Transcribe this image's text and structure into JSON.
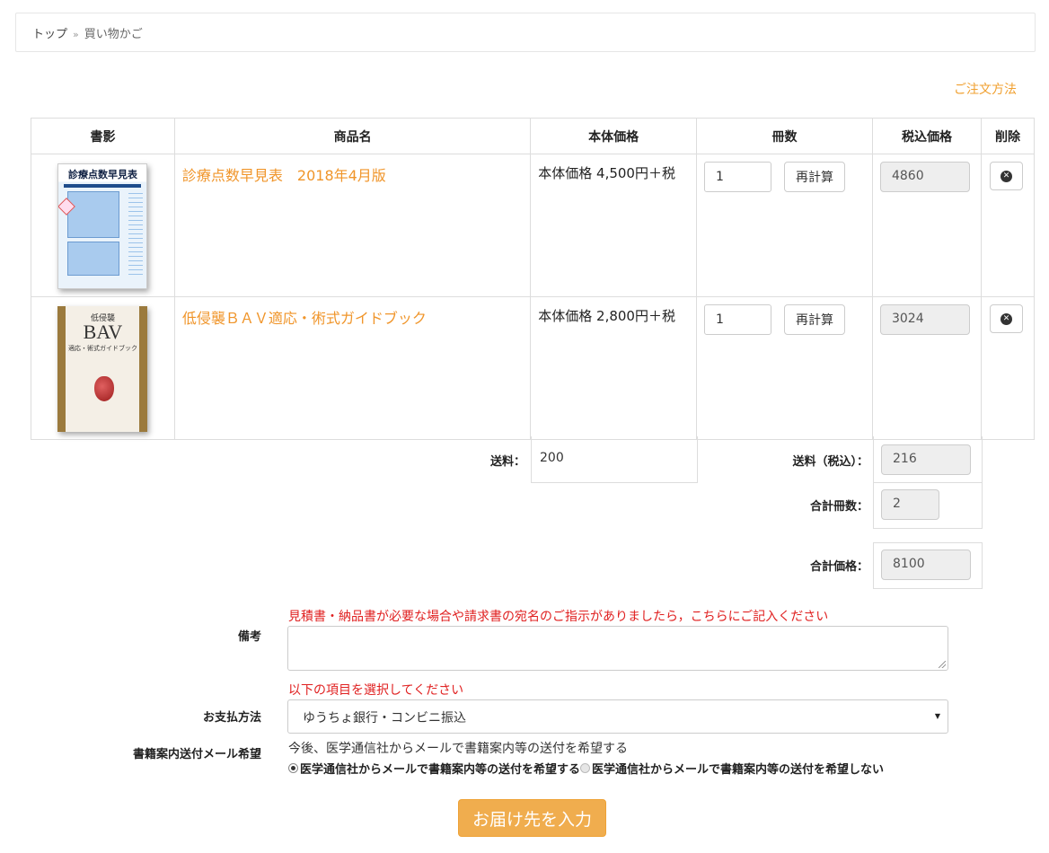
{
  "breadcrumb": {
    "home": "トップ",
    "separator": "»",
    "current": "買い物かご"
  },
  "order_method_link": "ご注文方法",
  "table": {
    "headers": {
      "image": "書影",
      "name": "商品名",
      "price": "本体価格",
      "quantity": "冊数",
      "tax_price": "税込価格",
      "delete": "削除"
    },
    "items": [
      {
        "name": "診療点数早見表　2018年4月版",
        "price": "本体価格 4,500円＋税",
        "quantity": "1",
        "recalc": "再計算",
        "tax_price": "4860",
        "cover": {
          "title": "診療点数早見表"
        }
      },
      {
        "name": "低侵襲ＢＡＶ適応・術式ガイドブック",
        "price": "本体価格 2,800円＋税",
        "quantity": "1",
        "recalc": "再計算",
        "tax_price": "3024",
        "cover": {
          "title1": "低侵襲",
          "title2": "BAV",
          "title3": "適応・術式ガイドブック"
        }
      }
    ]
  },
  "summary": {
    "shipping_label": "送料：",
    "shipping_value": "200",
    "shipping_tax_label": "送料（税込）：",
    "shipping_tax_value": "216",
    "total_qty_label": "合計冊数：",
    "total_qty_value": "2",
    "total_price_label": "合計価格：",
    "total_price_value": "8100"
  },
  "form": {
    "remarks_label": "備考",
    "remarks_note": "見積書・納品書が必要な場合や請求書の宛名のご指示がありましたら，こちらにご記入ください",
    "payment_note": "以下の項目を選択してください",
    "payment_label": "お支払方法",
    "payment_selected": "ゆうちょ銀行・コンビニ振込",
    "mail_label": "書籍案内送付メール希望",
    "mail_note": "今後、医学通信社からメールで書籍案内等の送付を希望する",
    "mail_yes": "医学通信社からメールで書籍案内等の送付を希望する",
    "mail_no": "医学通信社からメールで書籍案内等の送付を希望しない",
    "submit": "お届け先を入力"
  }
}
